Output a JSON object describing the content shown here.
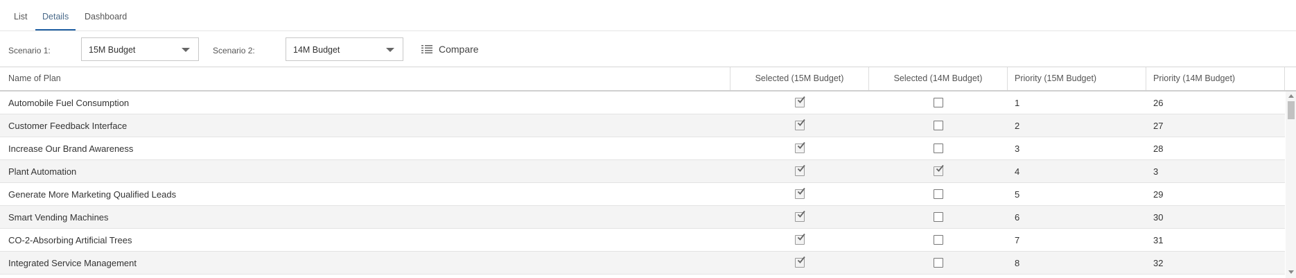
{
  "tabs": [
    {
      "label": "List",
      "active": false
    },
    {
      "label": "Details",
      "active": true
    },
    {
      "label": "Dashboard",
      "active": false
    }
  ],
  "toolbar": {
    "scenario1_label": "Scenario 1:",
    "scenario1_value": "15M Budget",
    "scenario2_label": "Scenario 2:",
    "scenario2_value": "14M Budget",
    "compare_label": "Compare",
    "compare_icon": "list-compare-icon"
  },
  "grid": {
    "columns": [
      "Name of Plan",
      "Selected (15M Budget)",
      "Selected (14M Budget)",
      "Priority (15M Budget)",
      "Priority (14M Budget)"
    ],
    "rows": [
      {
        "name": "Automobile Fuel Consumption",
        "sel15": true,
        "sel14": false,
        "pri15": "1",
        "pri14": "26"
      },
      {
        "name": "Customer Feedback Interface",
        "sel15": true,
        "sel14": false,
        "pri15": "2",
        "pri14": "27"
      },
      {
        "name": "Increase Our Brand Awareness",
        "sel15": true,
        "sel14": false,
        "pri15": "3",
        "pri14": "28"
      },
      {
        "name": "Plant Automation",
        "sel15": true,
        "sel14": true,
        "pri15": "4",
        "pri14": "3"
      },
      {
        "name": "Generate More Marketing Qualified Leads",
        "sel15": true,
        "sel14": false,
        "pri15": "5",
        "pri14": "29"
      },
      {
        "name": "Smart Vending Machines",
        "sel15": true,
        "sel14": false,
        "pri15": "6",
        "pri14": "30"
      },
      {
        "name": "CO-2-Absorbing Artificial Trees",
        "sel15": true,
        "sel14": false,
        "pri15": "7",
        "pri14": "31"
      },
      {
        "name": "Integrated Service Management",
        "sel15": true,
        "sel14": false,
        "pri15": "8",
        "pri14": "32"
      }
    ]
  },
  "colors": {
    "active_tab_underline": "#1f5fa3",
    "alt_row": "#f4f4f4"
  }
}
